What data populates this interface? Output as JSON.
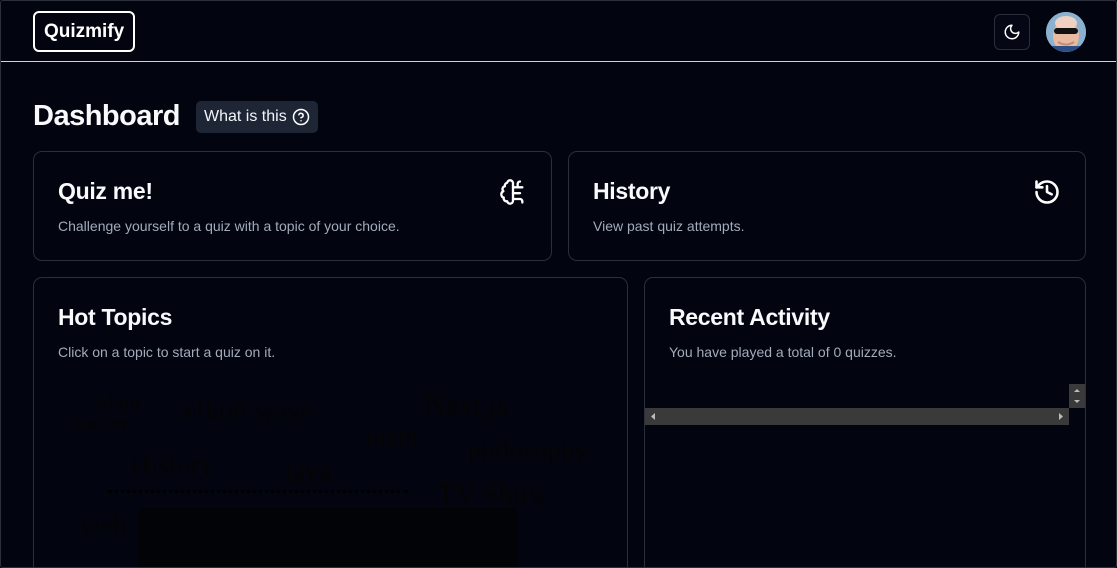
{
  "nav": {
    "logo": "Quizmify",
    "theme_icon": "moon-icon",
    "avatar_icon": "user-avatar"
  },
  "page": {
    "title": "Dashboard",
    "help_label": "What is this",
    "help_icon": "question-circle-icon"
  },
  "cards": {
    "quiz": {
      "title": "Quiz me!",
      "description": "Challenge yourself to a quiz with a topic of your choice.",
      "icon": "brain-circuit-icon"
    },
    "history": {
      "title": "History",
      "description": "View past quiz attempts.",
      "icon": "history-icon"
    },
    "hot_topics": {
      "title": "Hot Topics",
      "description": "Click on a topic to start a quiz on it.",
      "topics": [
        {
          "text": "islam"
        },
        {
          "text": "soccer"
        },
        {
          "text": "elliott wave"
        },
        {
          "text": "Next.js"
        },
        {
          "text": "math"
        },
        {
          "text": "philosophy"
        },
        {
          "text": "History"
        },
        {
          "text": "java"
        },
        {
          "text": "TV Show"
        },
        {
          "text": "web"
        }
      ]
    },
    "recent": {
      "title": "Recent Activity",
      "description": "You have played a total of 0 quizzes."
    }
  },
  "colors": {
    "background": "#02050f",
    "card_border": "#2a2f3a",
    "muted_text": "#a3acb9",
    "help_bg": "#1e2636"
  }
}
